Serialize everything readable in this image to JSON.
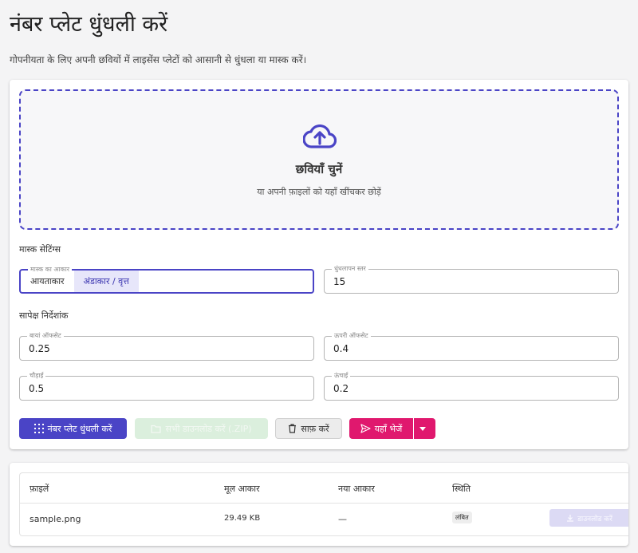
{
  "header": {
    "title": "नंबर प्लेट धुंधली करें",
    "subtitle": "गोपनीयता के लिए अपनी छवियों में लाइसेंस प्लेटों को आसानी से धुंधला या मास्क करें।"
  },
  "dropzone": {
    "icon": "cloud-upload-icon",
    "title": "छवियाँ चुनें",
    "hint": "या अपनी फ़ाइलों को यहाँ खींचकर छोड़ें"
  },
  "mask_settings": {
    "section_label": "मास्क सेटिंग्स",
    "shape": {
      "legend": "मास्क का आकार",
      "options": [
        "आयताकार",
        "अंडाकार / वृत्त"
      ],
      "selected": "अंडाकार / वृत्त"
    },
    "blur": {
      "legend": "धुंधलापन स्तर",
      "value": "15"
    }
  },
  "relative_coords": {
    "section_label": "सापेक्ष निर्देशांक",
    "left_offset": {
      "legend": "बायां ऑफसेट",
      "value": "0.25"
    },
    "top_offset": {
      "legend": "ऊपरी ऑफसेट",
      "value": "0.4"
    },
    "width": {
      "legend": "चौड़ाई",
      "value": "0.5"
    },
    "height": {
      "legend": "ऊंचाई",
      "value": "0.2"
    }
  },
  "actions": {
    "blur_label": "नंबर प्लेट धुंधली करें",
    "download_all_label": "सभी डाउनलोड करें (.ZIP)",
    "clear_label": "साफ़ करें",
    "send_label": "यहाँ भेजें",
    "colors": {
      "primary": "#4a44c6",
      "send": "#e0186e"
    }
  },
  "files_table": {
    "headers": {
      "file": "फ़ाइलें",
      "original_size": "मूल आकार",
      "new_size": "नया आकार",
      "status": "स्थिति"
    },
    "rows": [
      {
        "name": "sample.png",
        "original_size": "29.49 KB",
        "new_size": "—",
        "status": "लंबित",
        "download_label": "डाउनलोड करें"
      }
    ]
  }
}
